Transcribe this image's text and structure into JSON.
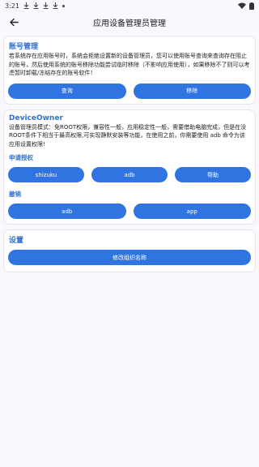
{
  "status": {
    "time": "3:21",
    "icons": [
      "download-icon",
      "download-icon",
      "download-icon",
      "download-icon",
      "dot-icon"
    ],
    "right_icons": [
      "wifi-icon",
      "battery-icon"
    ]
  },
  "toolbar": {
    "title": "应用设备管理员管理"
  },
  "account": {
    "heading": "账号管理",
    "description": "若系统存在应用账号时，系统会拒绝设置新的设备管理员，您可以使用账号查询来查询存在阻止的账号，然后使用系统的账号移除功能尝试临时移除（不影响应用使用），如果移除不了则可以考虑暂时卸载/冻结存在的账号软件！",
    "query_label": "查询",
    "remove_label": "移除"
  },
  "device_owner": {
    "heading": "DeviceOwner",
    "description": "设备管理员模式：免ROOT权限，兼容性一般，应用稳定性一般，需要借助电脑完成，但是在没ROOT条件下相当于最高权限,可实现静默安装等功能，在使用之前，你需要使用 adb 命令为该应用设置权限!",
    "grant_heading": "申请授权",
    "grant_buttons": [
      "shizuku",
      "adb",
      "帮助"
    ],
    "revoke_heading": "撤销",
    "revoke_buttons": [
      "adb",
      "app"
    ]
  },
  "settings": {
    "heading": "设置",
    "org_name_label": "修改组织名称"
  },
  "colors": {
    "accent": "#2f74e0",
    "heading": "#2f6fd6",
    "background": "#fbf8fd"
  }
}
